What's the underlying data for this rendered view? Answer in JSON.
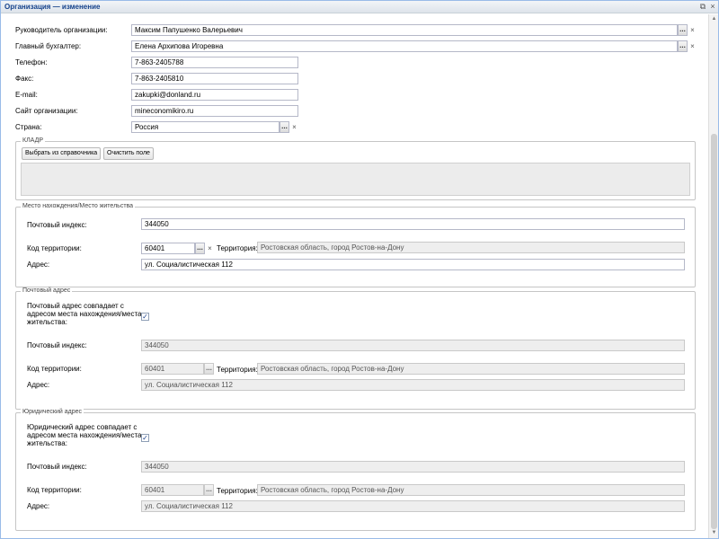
{
  "window": {
    "title": "Организация — изменение",
    "restore_icon": "restore-window-icon",
    "close_icon": "close-icon"
  },
  "main": {
    "head_label": "Руководитель организации:",
    "head_value": "Максим Папушенко Валерьевич",
    "accountant_label": "Главный бухгалтер:",
    "accountant_value": "Елена Архипова Игоревна",
    "phone_label": "Телефон:",
    "phone_value": "7-863-2405788",
    "fax_label": "Факс:",
    "fax_value": "7-863-2405810",
    "email_label": "E-mail:",
    "email_value": "zakupki@donland.ru",
    "site_label": "Сайт организации:",
    "site_value": "mineconomikiro.ru",
    "country_label": "Страна:",
    "country_value": "Россия"
  },
  "kladr": {
    "legend": "КЛАДР",
    "select_button": "Выбрать из справочника",
    "clear_button": "Очистить поле"
  },
  "location": {
    "legend": "Место нахождения/Место жительства",
    "postcode_label": "Почтовый индекс:",
    "postcode_value": "344050",
    "territory_code_label": "Код территории:",
    "territory_code_value": "60401",
    "territory_label": "Территория:",
    "territory_value": "Ростовская область, город Ростов-на-Дону",
    "address_label": "Адрес:",
    "address_value": "ул. Социалистическая 112"
  },
  "postal": {
    "legend": "Почтовый адрес",
    "same_label": "Почтовый адрес совпадает с адресом места нахождения/места жительства:",
    "same_checked": true,
    "postcode_label": "Почтовый индекс:",
    "postcode_value": "344050",
    "territory_code_label": "Код территории:",
    "territory_code_value": "60401",
    "territory_label": "Территория:",
    "territory_value": "Ростовская область, город Ростов-на-Дону",
    "address_label": "Адрес:",
    "address_value": "ул. Социалистическая 112"
  },
  "legal": {
    "legend": "Юридический адрес",
    "same_label": "Юридический адрес совпадает с адресом места нахождения/места жительства:",
    "same_checked": true,
    "postcode_label": "Почтовый индекс:",
    "postcode_value": "344050",
    "territory_code_label": "Код территории:",
    "territory_code_value": "60401",
    "territory_label": "Территория:",
    "territory_value": "Ростовская область, город Ростов-на-Дону",
    "address_label": "Адрес:",
    "address_value": "ул. Социалистическая 112"
  },
  "glyphs": {
    "ellipsis": "...",
    "clear": "×",
    "check": "✓",
    "scroll_up": "▲",
    "scroll_down": "▼"
  }
}
